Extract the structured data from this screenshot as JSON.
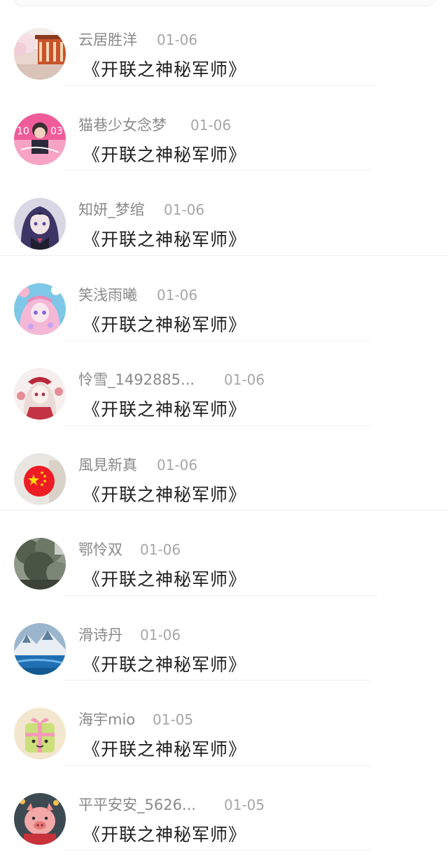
{
  "comments": [
    {
      "username": "云居胜洋",
      "date": "01-06",
      "title": "《开联之神秘军师》",
      "avatar_icon": "palace-photo-avatar-icon"
    },
    {
      "username": "猫巷少女念梦",
      "date": "01-06",
      "title": "《开联之神秘军师》",
      "avatar_icon": "pink-poster-avatar-icon"
    },
    {
      "username": "知妍_梦绾",
      "date": "01-06",
      "title": "《开联之神秘军师》",
      "avatar_icon": "anime-girl-avatar-icon"
    },
    {
      "username": "笑浅雨曦",
      "date": "01-06",
      "title": "《开联之神秘军师》",
      "avatar_icon": "pink-anime-avatar-icon"
    },
    {
      "username": "怜雪_1492885...",
      "date": "01-06",
      "title": "《开联之神秘军师》",
      "avatar_icon": "red-dress-anime-avatar-icon"
    },
    {
      "username": "風見新真",
      "date": "01-06",
      "title": "《开联之神秘军师》",
      "avatar_icon": "china-flag-badge-avatar-icon"
    },
    {
      "username": "鄂怜双",
      "date": "01-06",
      "title": "《开联之神秘军师》",
      "avatar_icon": "tree-photo-avatar-icon"
    },
    {
      "username": "滑诗丹",
      "date": "01-06",
      "title": "《开联之神秘军师》",
      "avatar_icon": "snow-mountain-avatar-icon"
    },
    {
      "username": "海宇mio",
      "date": "01-05",
      "title": "《开联之神秘军师》",
      "avatar_icon": "cartoon-gift-avatar-icon"
    },
    {
      "username": "平平安安_5626...",
      "date": "01-05",
      "title": "《开联之神秘军师》",
      "avatar_icon": "cartoon-pig-avatar-icon"
    }
  ],
  "colors": {
    "username": "#8a8a8a",
    "date": "#a6a6a6",
    "title": "#1e1e1e",
    "divider": "#f1f1f1"
  }
}
